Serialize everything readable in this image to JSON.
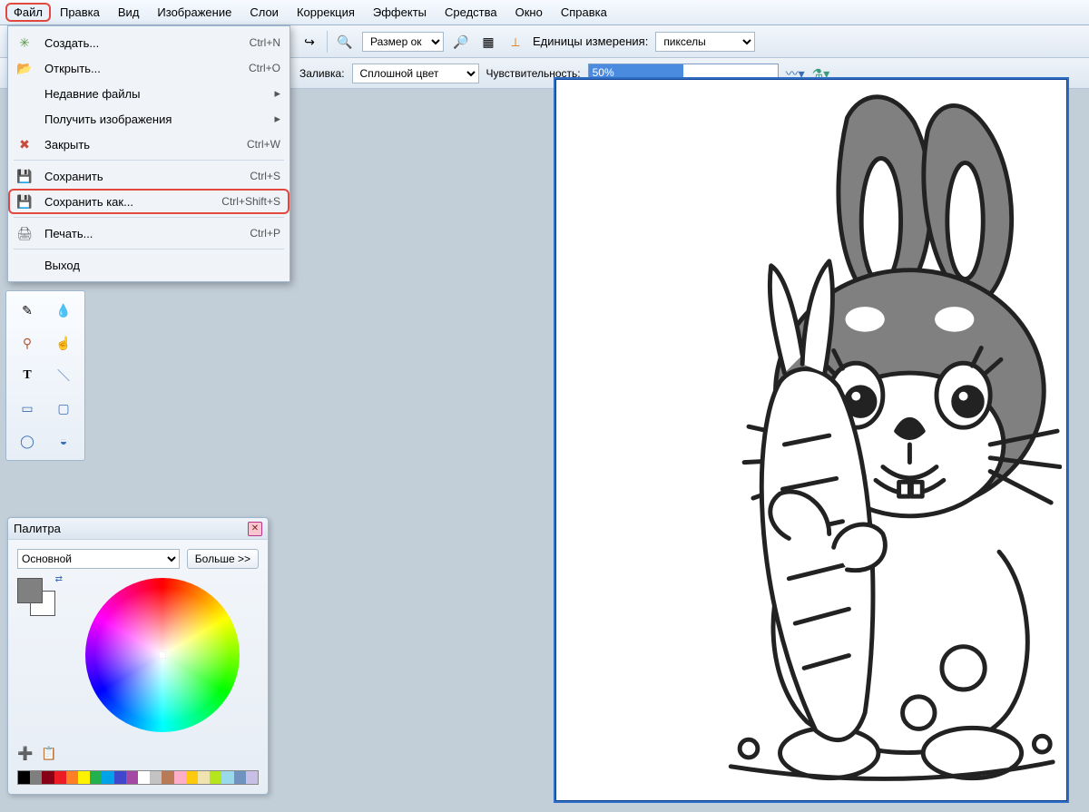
{
  "menubar": {
    "items": [
      "Файл",
      "Правка",
      "Вид",
      "Изображение",
      "Слои",
      "Коррекция",
      "Эффекты",
      "Средства",
      "Окно",
      "Справка"
    ],
    "highlighted_index": 0
  },
  "file_menu": {
    "items": [
      {
        "icon": "new-icon",
        "label": "Создать...",
        "shortcut": "Ctrl+N",
        "submenu": false
      },
      {
        "icon": "open-icon",
        "label": "Открыть...",
        "shortcut": "Ctrl+O",
        "submenu": false
      },
      {
        "icon": "",
        "label": "Недавние файлы",
        "shortcut": "",
        "submenu": true
      },
      {
        "icon": "",
        "label": "Получить изображения",
        "shortcut": "",
        "submenu": true
      },
      {
        "icon": "close-file-icon",
        "label": "Закрыть",
        "shortcut": "Ctrl+W",
        "submenu": false
      },
      {
        "sep": true
      },
      {
        "icon": "save-icon",
        "label": "Сохранить",
        "shortcut": "Ctrl+S",
        "submenu": false
      },
      {
        "icon": "save-as-icon",
        "label": "Сохранить как...",
        "shortcut": "Ctrl+Shift+S",
        "submenu": false,
        "highlighted": true
      },
      {
        "sep": true
      },
      {
        "icon": "print-icon",
        "label": "Печать...",
        "shortcut": "Ctrl+P",
        "submenu": false
      },
      {
        "sep": true
      },
      {
        "icon": "",
        "label": "Выход",
        "shortcut": "",
        "submenu": false
      }
    ]
  },
  "optbar": {
    "size_label": "Размер ок",
    "units_label": "Единицы измерения:",
    "units_value": "пикселы"
  },
  "optbar2": {
    "fill_label": "Заливка:",
    "fill_value": "Сплошной цвет",
    "sensitivity_label": "Чувствительность:",
    "sensitivity_value": "50%"
  },
  "palette": {
    "title": "Палитра",
    "preset": "Основной",
    "more_label": "Больше >>",
    "swatches": [
      "#000000",
      "#7f7f7f",
      "#880015",
      "#ed1c24",
      "#ff7f27",
      "#fff200",
      "#22b14c",
      "#00a2e8",
      "#3f48cc",
      "#a349a4",
      "#ffffff",
      "#c3c3c3",
      "#b97a57",
      "#ffaec9",
      "#ffc90e",
      "#efe4b0",
      "#b5e61d",
      "#99d9ea",
      "#7092be",
      "#c8bfe7"
    ]
  },
  "tools": {
    "items": [
      "pencil-tool",
      "eyedropper-tool",
      "clone-tool",
      "smudge-tool",
      "text-tool",
      "line-tool",
      "rect-tool",
      "roundrect-tool",
      "ellipse-tool",
      "shape-tool"
    ]
  }
}
